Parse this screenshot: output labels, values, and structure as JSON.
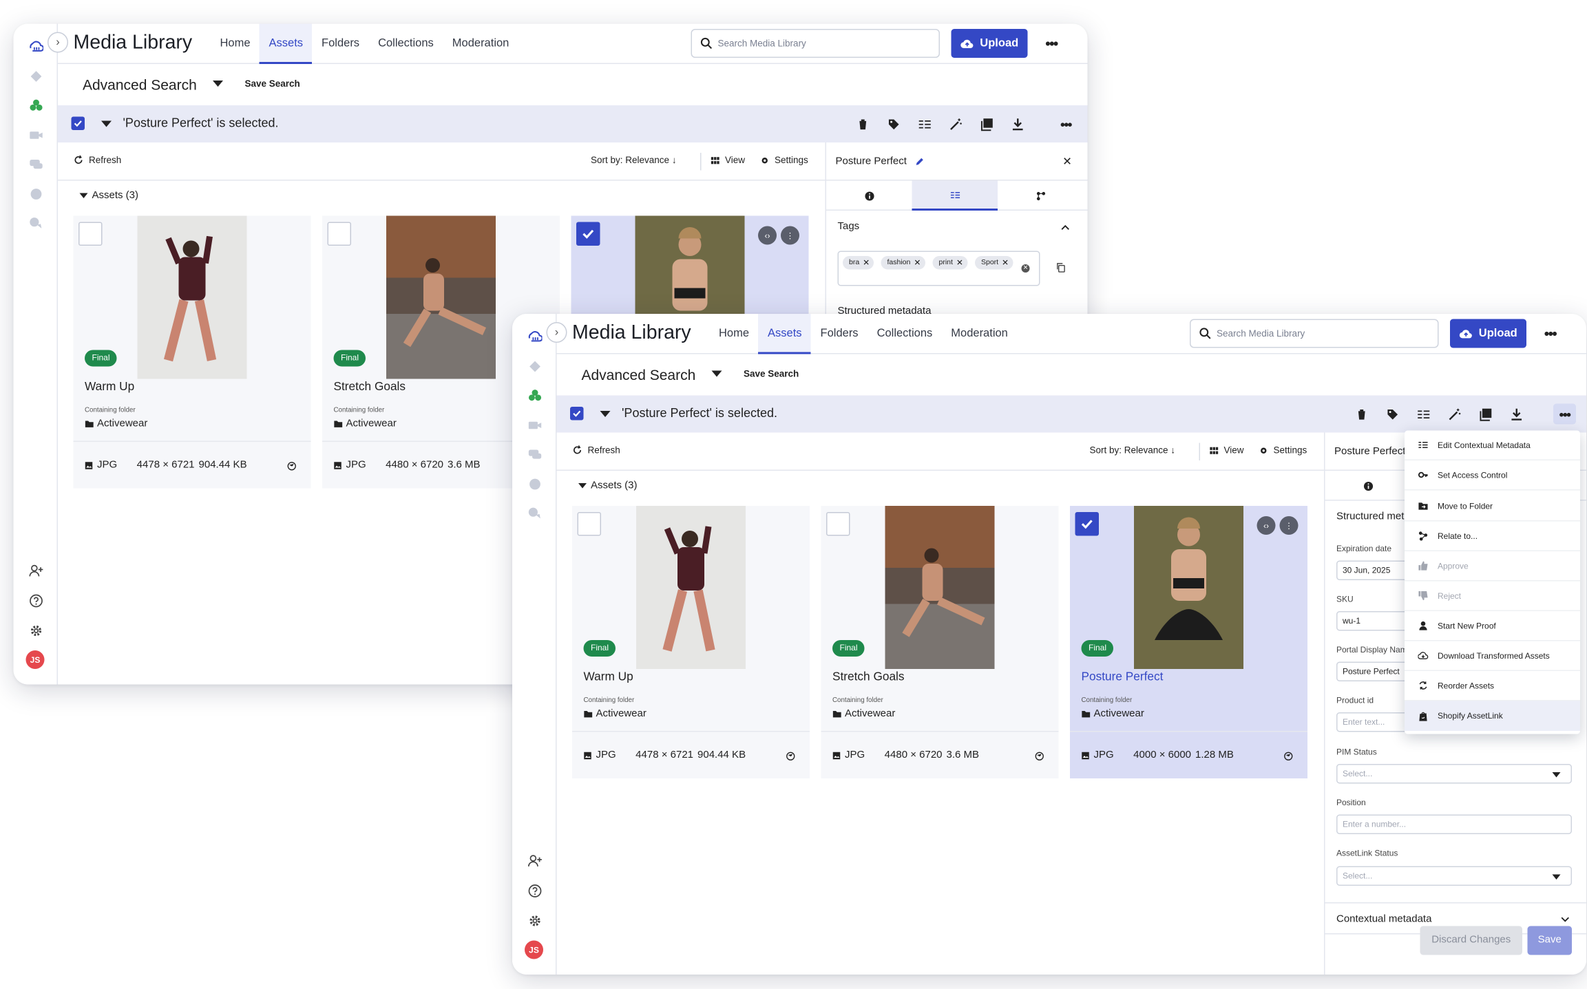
{
  "app": {
    "title": "Media Library",
    "nav": [
      "Home",
      "Assets",
      "Folders",
      "Collections",
      "Moderation"
    ],
    "active_nav": "Assets",
    "search_placeholder": "Search Media Library",
    "upload_label": "Upload",
    "avatar_initials": "JS"
  },
  "search_bar": {
    "title": "Advanced Search",
    "save_label": "Save Search"
  },
  "selection": {
    "text": "'Posture Perfect' is selected."
  },
  "toolbar": {
    "refresh": "Refresh",
    "sort": "Sort by: Relevance",
    "view": "View",
    "settings": "Settings"
  },
  "assets": {
    "heading": "Assets (3)",
    "items": [
      {
        "title": "Warm Up",
        "status": "Final",
        "folder_label": "Containing folder",
        "folder": "Activewear",
        "format": "JPG",
        "dims": "4478 × 6721",
        "size": "904.44 KB",
        "selected": false
      },
      {
        "title": "Stretch Goals",
        "status": "Final",
        "folder_label": "Containing folder",
        "folder": "Activewear",
        "format": "JPG",
        "dims": "4480 × 6720",
        "size": "3.6 MB",
        "selected": false
      },
      {
        "title": "Posture Perfect",
        "status": "Final",
        "folder_label": "Containing folder",
        "folder": "Activewear",
        "format": "JPG",
        "dims": "4000 × 6000",
        "size": "1.28 MB",
        "selected": true
      }
    ]
  },
  "back_panel": {
    "title": "Posture Perfect",
    "tags_heading": "Tags",
    "tags": [
      "bra",
      "fashion",
      "print",
      "Sport"
    ],
    "structured_heading": "Structured metadata"
  },
  "front_panel": {
    "title": "Posture Perfect",
    "structured_heading": "Structured metadata",
    "fields": [
      {
        "label": "Expiration date",
        "value": "30 Jun, 2025",
        "placeholder": false,
        "dropdown": false
      },
      {
        "label": "SKU",
        "value": "wu-1",
        "placeholder": false,
        "dropdown": false
      },
      {
        "label": "Portal Display Name",
        "value": "Posture Perfect",
        "placeholder": false,
        "dropdown": false
      },
      {
        "label": "Product id",
        "value": "Enter text...",
        "placeholder": true,
        "dropdown": false
      },
      {
        "label": "PIM Status",
        "value": "Select...",
        "placeholder": true,
        "dropdown": true
      },
      {
        "label": "Position",
        "value": "Enter a number...",
        "placeholder": true,
        "dropdown": false
      },
      {
        "label": "AssetLink Status",
        "value": "Select...",
        "placeholder": true,
        "dropdown": true
      }
    ],
    "contextual_heading": "Contextual metadata",
    "discard_label": "Discard Changes",
    "save_label": "Save"
  },
  "context_menu": {
    "items": [
      {
        "label": "Edit Contextual Metadata",
        "icon": "list-icon",
        "disabled": false
      },
      {
        "label": "Set Access Control",
        "icon": "key-icon",
        "disabled": false
      },
      {
        "label": "Move to Folder",
        "icon": "folder-move-icon",
        "disabled": false
      },
      {
        "label": "Relate to...",
        "icon": "relate-icon",
        "disabled": false
      },
      {
        "label": "Approve",
        "icon": "thumbs-up-icon",
        "disabled": true
      },
      {
        "label": "Reject",
        "icon": "thumbs-down-icon",
        "disabled": true
      },
      {
        "label": "Start New Proof",
        "icon": "user-proof-icon",
        "disabled": false
      },
      {
        "label": "Download Transformed Assets",
        "icon": "cloud-download-icon",
        "disabled": false
      },
      {
        "label": "Reorder Assets",
        "icon": "reorder-icon",
        "disabled": false
      },
      {
        "label": "Shopify AssetLink",
        "icon": "shopify-icon",
        "disabled": false
      }
    ]
  },
  "colors": {
    "accent": "#3448c5",
    "badge": "#1f8a4c",
    "selection_bg": "#e8eaf6",
    "card_selected": "#d9dcf5",
    "avatar": "#e5484d"
  }
}
